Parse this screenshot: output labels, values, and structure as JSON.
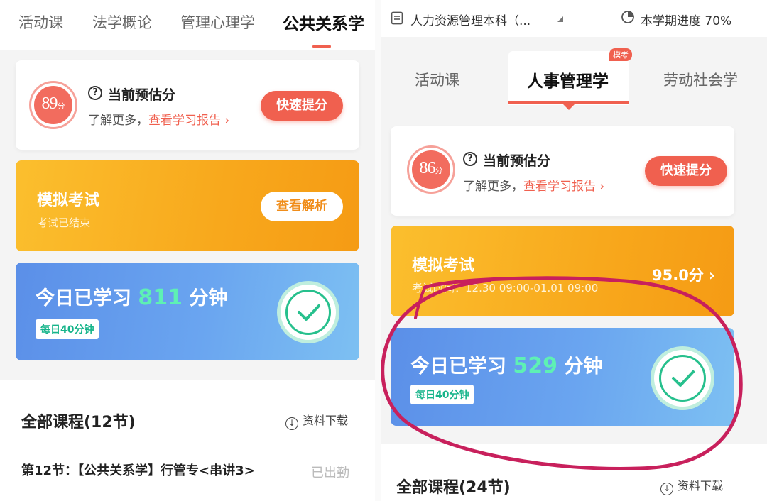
{
  "left": {
    "tabs": [
      {
        "label": "活动课",
        "active": false
      },
      {
        "label": "法学概论",
        "active": false
      },
      {
        "label": "管理心理学",
        "active": false
      },
      {
        "label": "公共关系学",
        "active": true
      }
    ],
    "score": {
      "value": "89",
      "unit": "分",
      "title": "当前预估分",
      "sub_prefix": "了解更多，",
      "sub_link": "查看学习报告 ›",
      "button": "快速提分"
    },
    "exam": {
      "title": "模拟考试",
      "subtitle": "考试已结束",
      "button": "查看解析"
    },
    "study": {
      "prefix": "今日已学习",
      "minutes": "811",
      "suffix": "分钟",
      "daily_goal": "每日40分钟"
    },
    "courses": {
      "title": "全部课程(12节)",
      "download": "资料下载"
    },
    "lesson": {
      "title": "第12节：【公共关系学】行管专<串讲3>",
      "status": "已出勤"
    }
  },
  "right": {
    "header": {
      "course_name": "人力资源管理本科（...",
      "progress_label": "本学期进度 70%"
    },
    "tabs": [
      {
        "label": "活动课",
        "active": false
      },
      {
        "label": "人事管理学",
        "active": true,
        "badge": "模考"
      },
      {
        "label": "劳动社会学",
        "active": false
      }
    ],
    "score": {
      "value": "86",
      "unit": "分",
      "title": "当前预估分",
      "sub_prefix": "了解更多，",
      "sub_link": "查看学习报告 ›",
      "button": "快速提分"
    },
    "exam": {
      "title": "模拟考试",
      "subtitle": "考试时间：12.30 09:00-01.01 09:00",
      "score": "95.0分 ›"
    },
    "study": {
      "prefix": "今日已学习",
      "minutes": "529",
      "suffix": "分钟",
      "daily_goal": "每日40分钟"
    },
    "courses": {
      "title": "全部课程(24节)",
      "download": "资料下载"
    }
  },
  "colors": {
    "accent": "#f0604f",
    "exam": "#f8a81c",
    "study": "#6aa5f0",
    "check": "#27c08d",
    "annotation": "#c8205c"
  },
  "icons": [
    "question-circle-icon",
    "download-icon",
    "checkmark-icon",
    "calendar-icon",
    "pie-progress-icon",
    "chevron-down-icon"
  ]
}
